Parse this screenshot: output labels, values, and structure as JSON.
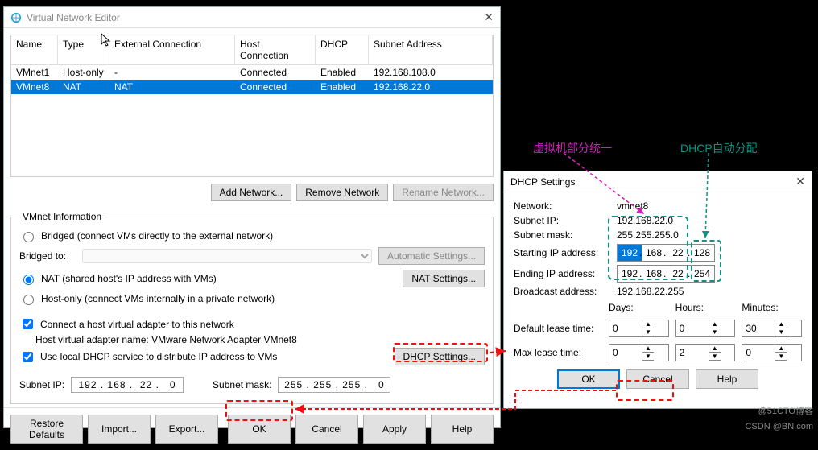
{
  "vne": {
    "title": "Virtual Network Editor",
    "columns": {
      "name": "Name",
      "type": "Type",
      "ext": "External Connection",
      "host": "Host Connection",
      "dhcp": "DHCP",
      "subnet": "Subnet Address"
    },
    "rows": [
      {
        "name": "VMnet1",
        "type": "Host-only",
        "ext": "-",
        "host": "Connected",
        "dhcp": "Enabled",
        "subnet": "192.168.108.0"
      },
      {
        "name": "VMnet8",
        "type": "NAT",
        "ext": "NAT",
        "host": "Connected",
        "dhcp": "Enabled",
        "subnet": "192.168.22.0"
      }
    ],
    "add": "Add Network...",
    "remove": "Remove Network",
    "rename": "Rename Network...",
    "group": "VMnet Information",
    "bridged": "Bridged (connect VMs directly to the external network)",
    "bridged_to": "Bridged to:",
    "auto": "Automatic Settings...",
    "nat": "NAT (shared host's IP address with VMs)",
    "nat_btn": "NAT Settings...",
    "host_only": "Host-only (connect VMs internally in a private network)",
    "connect_host": "Connect a host virtual adapter to this network",
    "host_adapter_name": "Host virtual adapter name: VMware Network Adapter VMnet8",
    "use_dhcp": "Use local DHCP service to distribute IP address to VMs",
    "dhcp_btn": "DHCP Settings...",
    "subnet_ip_lbl": "Subnet IP:",
    "subnet_ip": "192 . 168 .  22 .   0",
    "subnet_mask_lbl": "Subnet mask:",
    "subnet_mask": "255 . 255 . 255 .   0",
    "restore": "Restore Defaults",
    "import": "Import...",
    "export": "Export...",
    "ok": "OK",
    "cancel": "Cancel",
    "apply": "Apply",
    "help": "Help"
  },
  "dhcp": {
    "title": "DHCP Settings",
    "network_lbl": "Network:",
    "network": "vmnet8",
    "subnet_ip_lbl": "Subnet IP:",
    "subnet_ip": "192.168.22.0",
    "subnet_mask_lbl": "Subnet mask:",
    "subnet_mask": "255.255.255.0",
    "start_lbl": "Starting IP address:",
    "start": [
      "192",
      "168",
      "22",
      "128"
    ],
    "end_lbl": "Ending IP address:",
    "end": [
      "192",
      "168",
      "22",
      "254"
    ],
    "bcast_lbl": "Broadcast address:",
    "bcast": "192.168.22.255",
    "days": "Days:",
    "hours": "Hours:",
    "minutes": "Minutes:",
    "def_lease": "Default lease time:",
    "def": [
      "0",
      "0",
      "30"
    ],
    "max_lease": "Max lease time:",
    "max": [
      "0",
      "2",
      "0"
    ],
    "ok": "OK",
    "cancel": "Cancel",
    "help": "Help"
  },
  "ann": {
    "pink": "虚拟机部分统一",
    "teal": "DHCP自动分配"
  },
  "wm": {
    "a": "@51CTO博客",
    "b": "CSDN @BN.com"
  }
}
